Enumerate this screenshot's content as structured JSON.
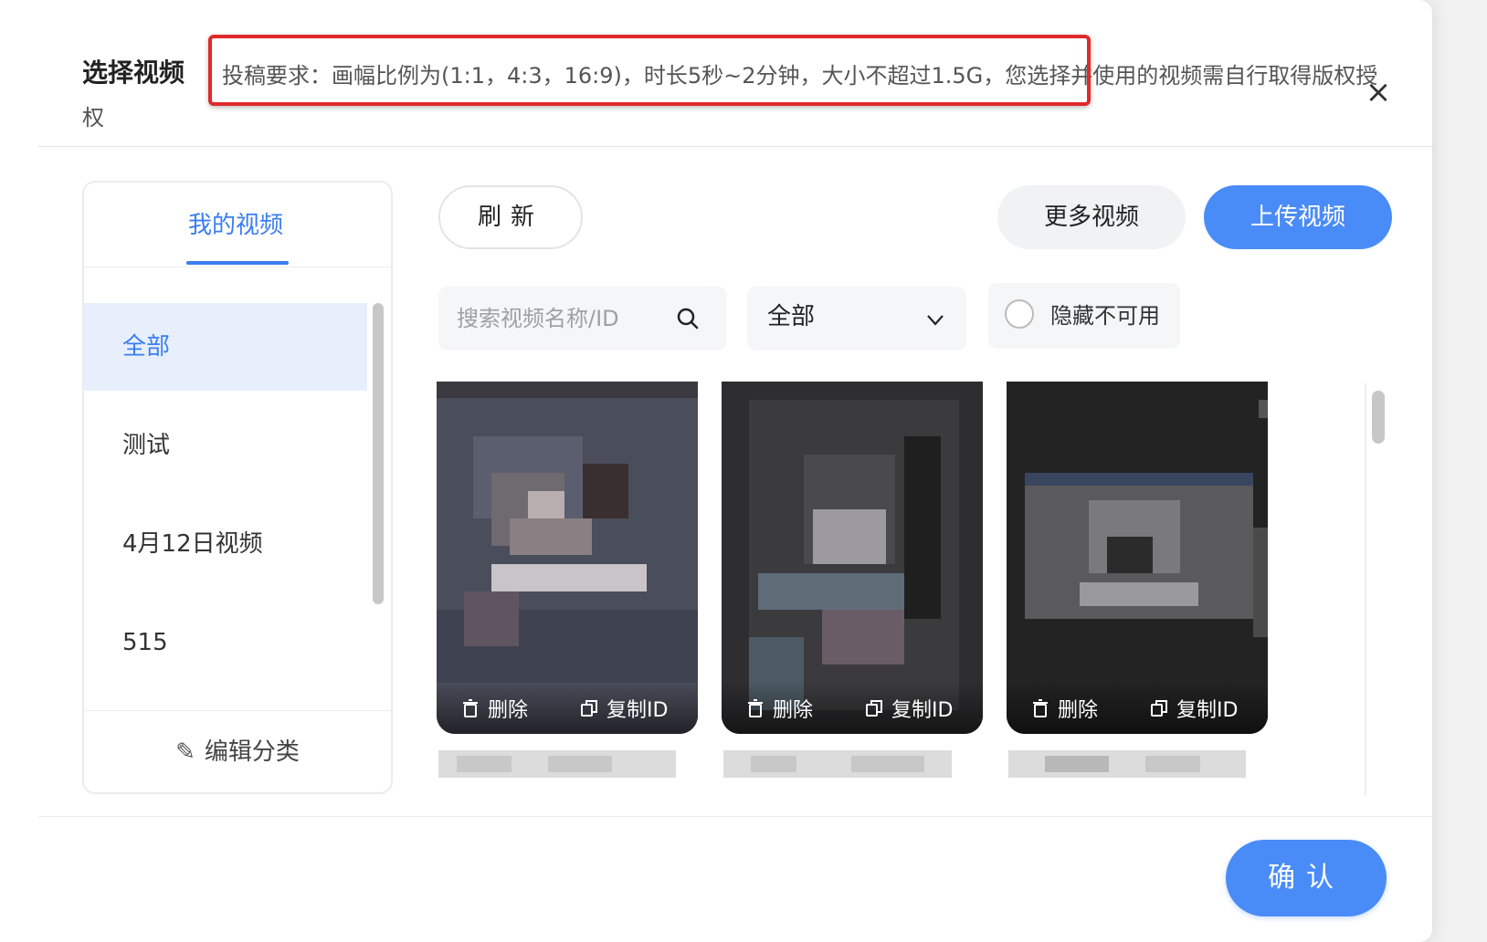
{
  "dialog": {
    "title": "选择视频",
    "notice": "投稿要求：画幅比例为(1:1，4:3，16:9)，时长5秒~2分钟，大小不超过1.5G，您选择并使用的视频需自行取得版权授权",
    "close_label": "×"
  },
  "sidebar": {
    "tab_label": "我的视频",
    "categories": [
      {
        "label": "全部",
        "active": true
      },
      {
        "label": "测试",
        "active": false
      },
      {
        "label": "4月12日视频",
        "active": false
      },
      {
        "label": "515",
        "active": false
      }
    ],
    "edit_label": "编辑分类"
  },
  "toolbar": {
    "refresh_label": "刷新",
    "more_label": "更多视频",
    "upload_label": "上传视频"
  },
  "filters": {
    "search_placeholder": "搜索视频名称/ID",
    "select_value": "全部",
    "hide_unavailable_label": "隐藏不可用",
    "hide_unavailable_checked": false
  },
  "videos": [
    {
      "delete_label": "删除",
      "copy_label": "复制ID"
    },
    {
      "delete_label": "删除",
      "copy_label": "复制ID"
    },
    {
      "delete_label": "删除",
      "copy_label": "复制ID"
    }
  ],
  "footer": {
    "confirm_label": "确认"
  },
  "colors": {
    "accent": "#4a8cf7",
    "highlight_border": "#e0292b",
    "active_bg": "#e8effc"
  }
}
